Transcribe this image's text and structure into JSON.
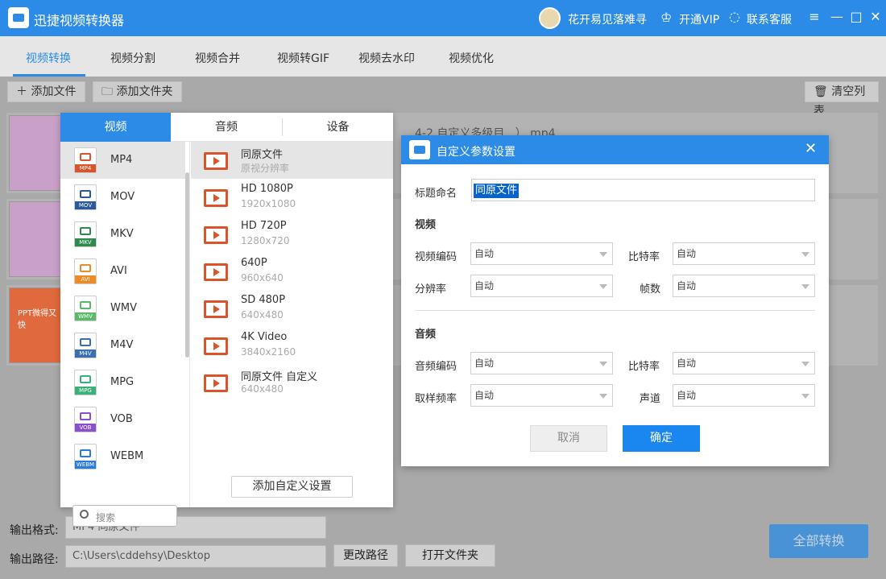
{
  "titlebar": {
    "app_title": "迅捷视频转换器",
    "username": "花开易见落难寻",
    "vip_label": "开通VIP",
    "service_label": "联系客服",
    "minimize": "—",
    "maximize": "□",
    "close": "✕"
  },
  "tabs": [
    "视频转换",
    "视频分割",
    "视频合并",
    "视频转GIF",
    "视频去水印",
    "视频优化"
  ],
  "toolbar": {
    "add_file": "＋ 添加文件",
    "add_folder": "🗀 添加文件夹",
    "clear_list": "🗑 清空列表"
  },
  "files": {
    "first_name": "4-2 自定义多级目...）.mp4",
    "ppt_thumb_text": "PPT微得又快"
  },
  "format_panel": {
    "tabs": [
      "视频",
      "音频",
      "设备"
    ],
    "formats": [
      {
        "label": "MP4",
        "color": "#d9542a"
      },
      {
        "label": "MOV",
        "color": "#2a5a9a"
      },
      {
        "label": "MKV",
        "color": "#2e8b4e"
      },
      {
        "label": "AVI",
        "color": "#f08a24"
      },
      {
        "label": "WMV",
        "color": "#5ab96a"
      },
      {
        "label": "M4V",
        "color": "#3a6fb0"
      },
      {
        "label": "MPG",
        "color": "#3ab07a"
      },
      {
        "label": "VOB",
        "color": "#8a4fcf"
      },
      {
        "label": "WEBM",
        "color": "#2a7ad9"
      }
    ],
    "presets": [
      {
        "name": "同原文件",
        "sub": "原视分辨率"
      },
      {
        "name": "HD 1080P",
        "sub": "1920x1080"
      },
      {
        "name": "HD 720P",
        "sub": "1280x720"
      },
      {
        "name": "640P",
        "sub": "960x640"
      },
      {
        "name": "SD 480P",
        "sub": "640x480"
      },
      {
        "name": "4K Video",
        "sub": "3840x2160"
      },
      {
        "name": "同原文件 自定义",
        "sub": "640x480"
      }
    ],
    "search_placeholder": "搜索",
    "add_custom": "添加自定义设置"
  },
  "dialog": {
    "title": "自定义参数设置",
    "close": "✕",
    "name_label": "标题命名",
    "name_value": "同原文件",
    "video_section": "视频",
    "video_codec_label": "视频编码",
    "video_codec": "自动",
    "video_bitrate_label": "比特率",
    "video_bitrate": "自动",
    "resolution_label": "分辨率",
    "resolution": "自动",
    "framerate_label": "帧数",
    "framerate": "自动",
    "audio_section": "音频",
    "audio_codec_label": "音频编码",
    "audio_codec": "自动",
    "audio_bitrate_label": "比特率",
    "audio_bitrate": "自动",
    "samplerate_label": "取样频率",
    "samplerate": "自动",
    "channel_label": "声道",
    "channel": "自动",
    "cancel": "取消",
    "ok": "确定"
  },
  "bottom": {
    "format_label": "输出格式:",
    "format_value": "MP4  同原文件",
    "path_label": "输出路径:",
    "path_value": "C:\\Users\\cddehsy\\Desktop",
    "change_path": "更改路径",
    "open_folder": "打开文件夹",
    "convert_all": "全部转换"
  }
}
